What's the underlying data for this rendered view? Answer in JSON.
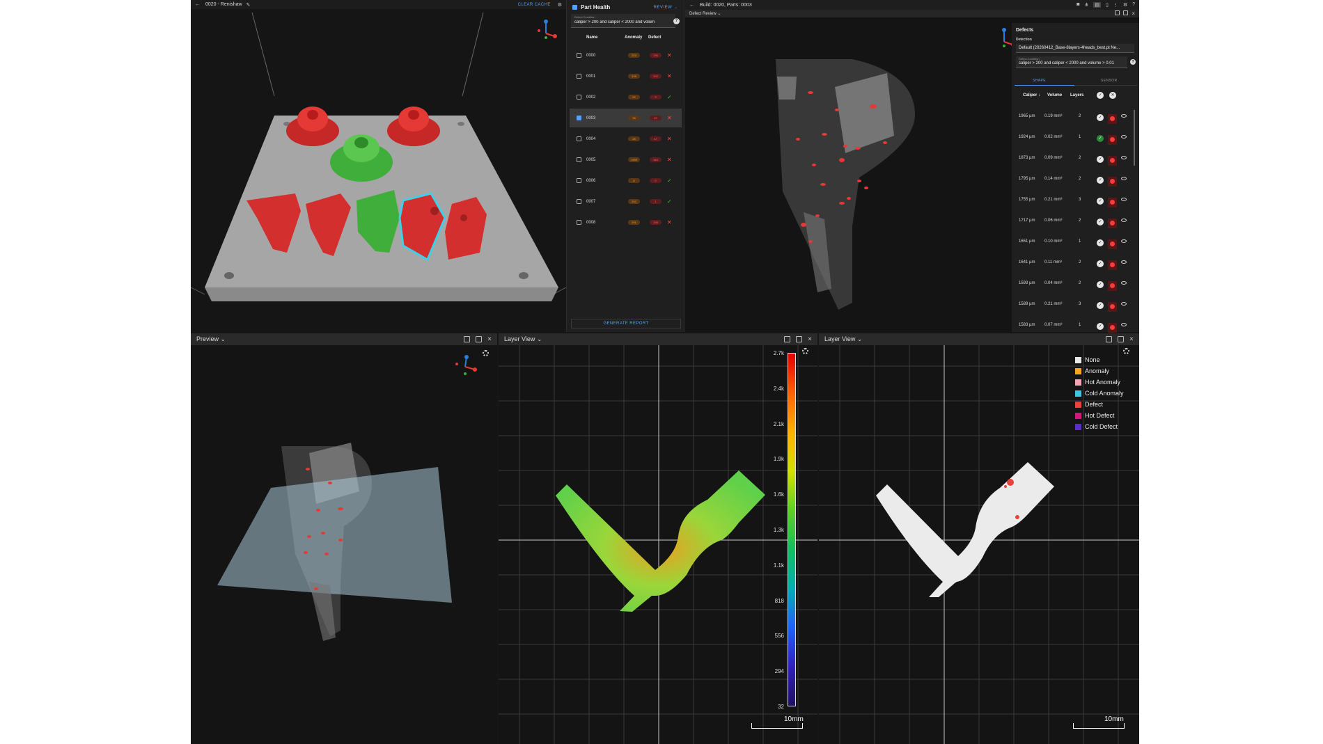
{
  "top_left": {
    "title": "0020 - Renishaw",
    "clear_cache": "CLEAR CACHE"
  },
  "part_health": {
    "title": "Part Health",
    "review": "REVIEW →",
    "cond_label": "Defect Condition",
    "cond_value": "caliper > 200 and caliper < 2000 and volum",
    "col_name": "Name",
    "col_anomaly": "Anomaly",
    "col_defect": "Defect",
    "rows": [
      {
        "name": "0000",
        "anomaly": "223",
        "defect": "136",
        "status": "bad",
        "checked": false
      },
      {
        "name": "0001",
        "anomaly": "139",
        "defect": "102",
        "status": "bad",
        "checked": false
      },
      {
        "name": "0002",
        "anomaly": "22",
        "defect": "3",
        "status": "ok",
        "checked": false
      },
      {
        "name": "0003",
        "anomaly": "36",
        "defect": "22",
        "status": "bad",
        "checked": true
      },
      {
        "name": "0004",
        "anomaly": "28",
        "defect": "47",
        "status": "bad",
        "checked": false
      },
      {
        "name": "0005",
        "anomaly": "1999",
        "defect": "346",
        "status": "bad",
        "checked": false
      },
      {
        "name": "0006",
        "anomaly": "8",
        "defect": "0",
        "status": "ok",
        "checked": false
      },
      {
        "name": "0007",
        "anomaly": "253",
        "defect": "1",
        "status": "ok",
        "checked": false
      },
      {
        "name": "0008",
        "anomaly": "291",
        "defect": "158",
        "status": "bad",
        "checked": false
      }
    ],
    "generate": "GENERATE REPORT"
  },
  "top_right": {
    "title": "Build: 0020, Parts: 0003",
    "subtitle": "Defect Review ⌄"
  },
  "defects": {
    "title": "Defects",
    "detection_label": "Detection",
    "detection_value": "Default (20260412_Base-8layers-4heads_best.pt Ne...",
    "cond_label": "Defect Condition",
    "cond_value": "caliper > 200 and caliper < 2000 and volume > 0.01",
    "tab_shape": "SHAPE",
    "tab_sensor": "SENSOR",
    "col_caliper": "Caliper ↓",
    "col_volume": "Volume",
    "col_layers": "Layers",
    "rows": [
      {
        "caliper": "1965 µm",
        "volume": "0.19 mm³",
        "layers": "2",
        "accepted": false
      },
      {
        "caliper": "1924 µm",
        "volume": "0.02 mm³",
        "layers": "1",
        "accepted": true
      },
      {
        "caliper": "1873 µm",
        "volume": "0.09 mm³",
        "layers": "2",
        "accepted": false
      },
      {
        "caliper": "1795 µm",
        "volume": "0.14 mm³",
        "layers": "2",
        "accepted": false
      },
      {
        "caliper": "1755 µm",
        "volume": "0.21 mm³",
        "layers": "3",
        "accepted": false
      },
      {
        "caliper": "1717 µm",
        "volume": "0.06 mm³",
        "layers": "2",
        "accepted": false
      },
      {
        "caliper": "1651 µm",
        "volume": "0.10 mm³",
        "layers": "1",
        "accepted": false
      },
      {
        "caliper": "1641 µm",
        "volume": "0.11 mm³",
        "layers": "2",
        "accepted": false
      },
      {
        "caliper": "1593 µm",
        "volume": "0.04 mm³",
        "layers": "2",
        "accepted": false
      },
      {
        "caliper": "1589 µm",
        "volume": "0.21 mm³",
        "layers": "3",
        "accepted": false
      },
      {
        "caliper": "1583 µm",
        "volume": "0.07 mm³",
        "layers": "1",
        "accepted": false
      }
    ]
  },
  "bottom": {
    "preview_title": "Preview ⌄",
    "layer_title_1": "Layer View ⌄",
    "layer_title_2": "Layer View ⌄",
    "scale_1": "10mm",
    "scale_2": "10mm",
    "colorbar": [
      "2.7k",
      "2.4k",
      "2.1k",
      "1.9k",
      "1.6k",
      "1.3k",
      "1.1k",
      "818",
      "556",
      "294",
      "32"
    ],
    "legend": [
      {
        "label": "None",
        "color": "#e8e8e8"
      },
      {
        "label": "Anomaly",
        "color": "#f5a623"
      },
      {
        "label": "Hot Anomaly",
        "color": "#f5a3b5"
      },
      {
        "label": "Cold Anomaly",
        "color": "#3ec6e0"
      },
      {
        "label": "Defect",
        "color": "#e8423c"
      },
      {
        "label": "Hot Defect",
        "color": "#d6157a"
      },
      {
        "label": "Cold Defect",
        "color": "#5b2fc7"
      }
    ]
  }
}
